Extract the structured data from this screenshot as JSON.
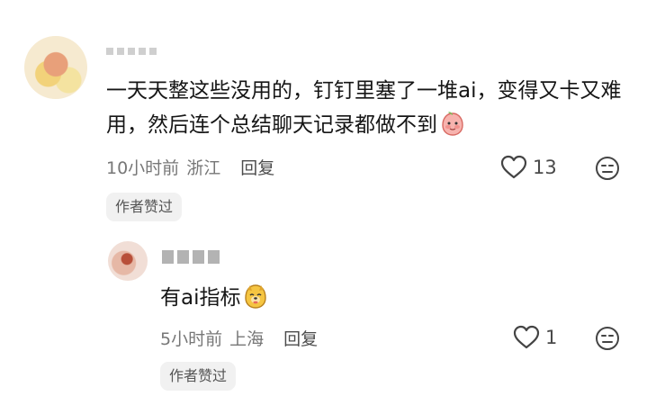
{
  "comments": [
    {
      "text": "一天天整这些没用的，钉钉里塞了一堆ai，变得又卡又难用，然后连个总结聊天记录都做不到",
      "time": "10小时前",
      "location": "浙江",
      "reply_label": "回复",
      "likes": "13",
      "badge": "作者赞过",
      "emoji_icon": "blushing-peach-icon"
    }
  ],
  "replies": [
    {
      "text": "有ai指标",
      "time": "5小时前",
      "location": "上海",
      "reply_label": "回复",
      "likes": "1",
      "badge": "作者赞过",
      "emoji_icon": "doge-face-icon"
    }
  ],
  "colors": {
    "text": "#161616",
    "meta": "#777777",
    "badge_bg": "#f1f1f1"
  }
}
